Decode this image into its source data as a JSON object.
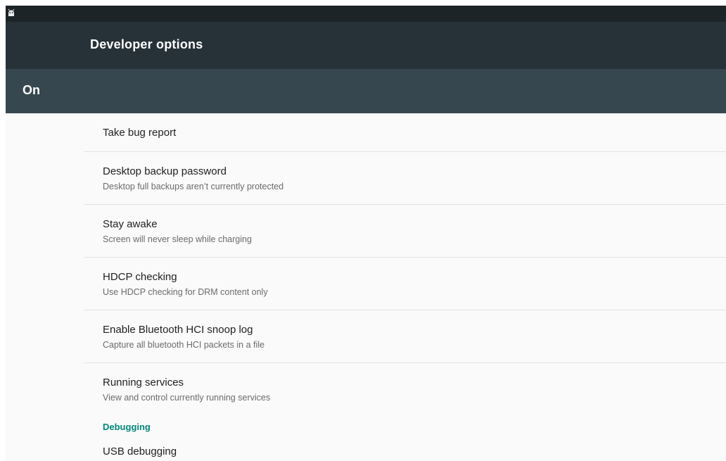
{
  "status_bar": {
    "icon": "android-debug-icon"
  },
  "action_bar": {
    "title": "Developer options"
  },
  "master_switch": {
    "label": "On"
  },
  "preferences": [
    {
      "title": "Take bug report",
      "summary": ""
    },
    {
      "title": "Desktop backup password",
      "summary": "Desktop full backups aren’t currently protected"
    },
    {
      "title": "Stay awake",
      "summary": "Screen will never sleep while charging"
    },
    {
      "title": "HDCP checking",
      "summary": "Use HDCP checking for DRM content only"
    },
    {
      "title": "Enable Bluetooth HCI snoop log",
      "summary": "Capture all bluetooth HCI packets in a file"
    },
    {
      "title": "Running services",
      "summary": "View and control currently running services"
    }
  ],
  "debugging": {
    "category": "Debugging",
    "items": [
      {
        "title": "USB debugging"
      }
    ]
  },
  "colors": {
    "status_bar": "#1c2428",
    "action_bar": "#263238",
    "switch_bar": "#37474f",
    "accent": "#00897b"
  }
}
